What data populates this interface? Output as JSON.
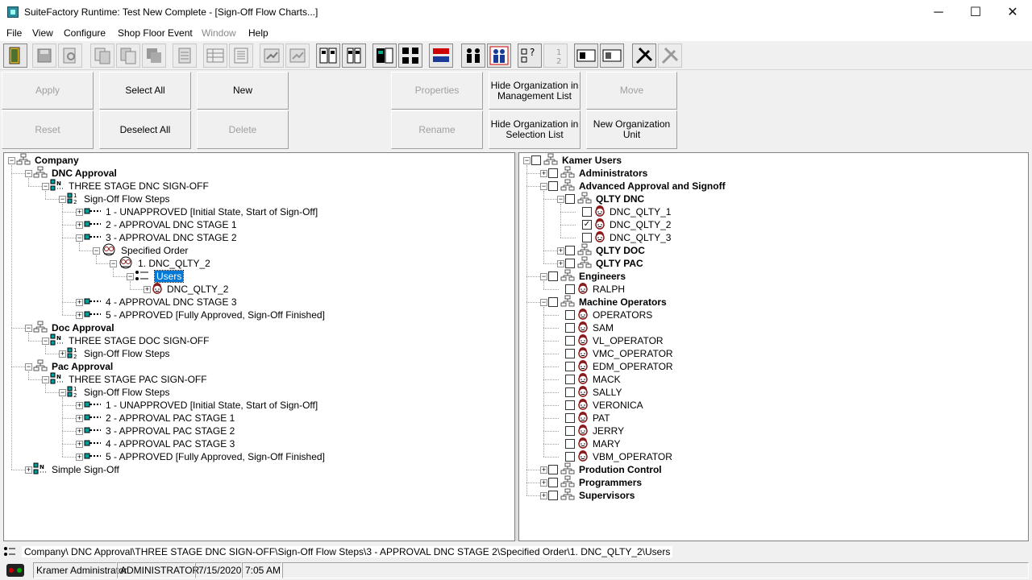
{
  "window": {
    "title": "SuiteFactory Runtime: Test New Complete - [Sign-Off Flow Charts...]",
    "controls": [
      "─",
      "☐",
      "✕"
    ]
  },
  "menu": [
    "File",
    "View",
    "Configure",
    "Shop Floor Event",
    "Window",
    "Help"
  ],
  "commands": {
    "apply": "Apply",
    "reset": "Reset",
    "select_all": "Select All",
    "deselect_all": "Deselect All",
    "new": "New",
    "delete": "Delete",
    "properties": "Properties",
    "rename": "Rename",
    "hide_mgmt": "Hide Organization in Management List",
    "hide_sel": "Hide Organization in Selection List",
    "move": "Move",
    "new_org": "New Organization Unit"
  },
  "left_tree": [
    {
      "label": "Company",
      "level": 0,
      "icon": "org-icon",
      "exp": "-",
      "bold": true
    },
    {
      "label": "DNC Approval",
      "level": 1,
      "icon": "org-icon",
      "exp": "-",
      "bold": true
    },
    {
      "label": "THREE STAGE DNC SIGN-OFF",
      "level": 2,
      "icon": "flow-icon",
      "exp": "-"
    },
    {
      "label": "Sign-Off Flow Steps",
      "level": 3,
      "icon": "steps-icon",
      "exp": "-"
    },
    {
      "label": "1 - UNAPPROVED [Initial State, Start of Sign-Off]",
      "level": 4,
      "icon": "step-icon",
      "exp": "+"
    },
    {
      "label": "2 - APPROVAL DNC STAGE 1",
      "level": 4,
      "icon": "step-icon",
      "exp": "+"
    },
    {
      "label": "3 - APPROVAL DNC STAGE 2",
      "level": 4,
      "icon": "step-icon",
      "exp": "-"
    },
    {
      "label": "Specified Order",
      "level": 5,
      "icon": "group-icon",
      "exp": "-"
    },
    {
      "label": "1. DNC_QLTY_2",
      "level": 6,
      "icon": "group-icon",
      "exp": "-"
    },
    {
      "label": "Users",
      "level": 7,
      "icon": "users-icon",
      "exp": "-",
      "selected": true
    },
    {
      "label": "DNC_QLTY_2",
      "level": 8,
      "icon": "user-icon",
      "exp": "+"
    },
    {
      "label": "4 - APPROVAL DNC STAGE 3",
      "level": 4,
      "icon": "step-icon",
      "exp": "+"
    },
    {
      "label": "5 - APPROVED [Fully Approved, Sign-Off Finished]",
      "level": 4,
      "icon": "step-icon",
      "exp": "+"
    },
    {
      "label": "Doc Approval",
      "level": 1,
      "icon": "org-icon",
      "exp": "-",
      "bold": true
    },
    {
      "label": "THREE STAGE DOC SIGN-OFF",
      "level": 2,
      "icon": "flow-icon",
      "exp": "-"
    },
    {
      "label": "Sign-Off Flow Steps",
      "level": 3,
      "icon": "steps-icon",
      "exp": "+"
    },
    {
      "label": "Pac Approval",
      "level": 1,
      "icon": "org-icon",
      "exp": "-",
      "bold": true
    },
    {
      "label": "THREE STAGE PAC SIGN-OFF",
      "level": 2,
      "icon": "flow-icon",
      "exp": "-"
    },
    {
      "label": "Sign-Off Flow Steps",
      "level": 3,
      "icon": "steps-icon",
      "exp": "-"
    },
    {
      "label": "1 - UNAPPROVED [Initial State, Start of Sign-Off]",
      "level": 4,
      "icon": "step-icon",
      "exp": "+"
    },
    {
      "label": "2 - APPROVAL PAC STAGE 1",
      "level": 4,
      "icon": "step-icon",
      "exp": "+"
    },
    {
      "label": "3 - APPROVAL PAC STAGE 2",
      "level": 4,
      "icon": "step-icon",
      "exp": "+"
    },
    {
      "label": "4 - APPROVAL PAC STAGE 3",
      "level": 4,
      "icon": "step-icon",
      "exp": "+"
    },
    {
      "label": "5 - APPROVED [Fully Approved, Sign-Off Finished]",
      "level": 4,
      "icon": "step-icon",
      "exp": "+"
    },
    {
      "label": "Simple Sign-Off",
      "level": 1,
      "icon": "flow-icon",
      "exp": "+"
    }
  ],
  "right_tree": [
    {
      "label": "Kamer Users",
      "level": 0,
      "icon": "org-icon",
      "exp": "-",
      "bold": true,
      "checked": false
    },
    {
      "label": "Administrators",
      "level": 1,
      "icon": "org-icon",
      "exp": "+",
      "bold": true,
      "checked": false
    },
    {
      "label": "Advanced Approval and Signoff",
      "level": 1,
      "icon": "org-icon",
      "exp": "-",
      "bold": true,
      "checked": false
    },
    {
      "label": "QLTY DNC",
      "level": 2,
      "icon": "org-icon",
      "exp": "-",
      "bold": true,
      "checked": false
    },
    {
      "label": "DNC_QLTY_1",
      "level": 3,
      "icon": "user-icon",
      "checked": false
    },
    {
      "label": "DNC_QLTY_2",
      "level": 3,
      "icon": "user-icon",
      "checked": true
    },
    {
      "label": "DNC_QLTY_3",
      "level": 3,
      "icon": "user-icon",
      "checked": false
    },
    {
      "label": "QLTY DOC",
      "level": 2,
      "icon": "org-icon",
      "exp": "+",
      "bold": true,
      "checked": false
    },
    {
      "label": "QLTY PAC",
      "level": 2,
      "icon": "org-icon",
      "exp": "+",
      "bold": true,
      "checked": false
    },
    {
      "label": "Engineers",
      "level": 1,
      "icon": "org-icon",
      "exp": "-",
      "bold": true,
      "checked": false
    },
    {
      "label": "RALPH",
      "level": 2,
      "icon": "user-icon",
      "checked": false
    },
    {
      "label": "Machine Operators",
      "level": 1,
      "icon": "org-icon",
      "exp": "-",
      "bold": true,
      "checked": false
    },
    {
      "label": "OPERATORS",
      "level": 2,
      "icon": "user-icon",
      "checked": false
    },
    {
      "label": "SAM",
      "level": 2,
      "icon": "user-icon",
      "checked": false
    },
    {
      "label": "VL_OPERATOR",
      "level": 2,
      "icon": "user-icon",
      "checked": false
    },
    {
      "label": "VMC_OPERATOR",
      "level": 2,
      "icon": "user-icon",
      "checked": false
    },
    {
      "label": "EDM_OPERATOR",
      "level": 2,
      "icon": "user-icon",
      "checked": false
    },
    {
      "label": "MACK",
      "level": 2,
      "icon": "user-icon",
      "checked": false
    },
    {
      "label": "SALLY",
      "level": 2,
      "icon": "user-icon",
      "checked": false
    },
    {
      "label": "VERONICA",
      "level": 2,
      "icon": "user-icon",
      "checked": false
    },
    {
      "label": "PAT",
      "level": 2,
      "icon": "user-icon",
      "checked": false
    },
    {
      "label": "JERRY",
      "level": 2,
      "icon": "user-icon",
      "checked": false
    },
    {
      "label": "MARY",
      "level": 2,
      "icon": "user-icon",
      "checked": false
    },
    {
      "label": "VBM_OPERATOR",
      "level": 2,
      "icon": "user-icon",
      "checked": false
    },
    {
      "label": "Prodution Control",
      "level": 1,
      "icon": "org-icon",
      "exp": "+",
      "bold": true,
      "checked": false
    },
    {
      "label": "Programmers",
      "level": 1,
      "icon": "org-icon",
      "exp": "+",
      "bold": true,
      "checked": false
    },
    {
      "label": "Supervisors",
      "level": 1,
      "icon": "org-icon",
      "exp": "+",
      "bold": true,
      "checked": false
    }
  ],
  "path": "Company\\ DNC Approval\\THREE STAGE DNC SIGN-OFF\\Sign-Off Flow Steps\\3 - APPROVAL DNC STAGE 2\\Specified Order\\1. DNC_QLTY_2\\Users",
  "status": {
    "user": "Kramer Administrator",
    "role": "ADMINISTRATOR",
    "date": "7/15/2020",
    "time": "7:05 AM"
  },
  "colors": {
    "selection": "#0078d7",
    "step_icon": "#00a0a0",
    "user_face": "#8b1a1a"
  }
}
